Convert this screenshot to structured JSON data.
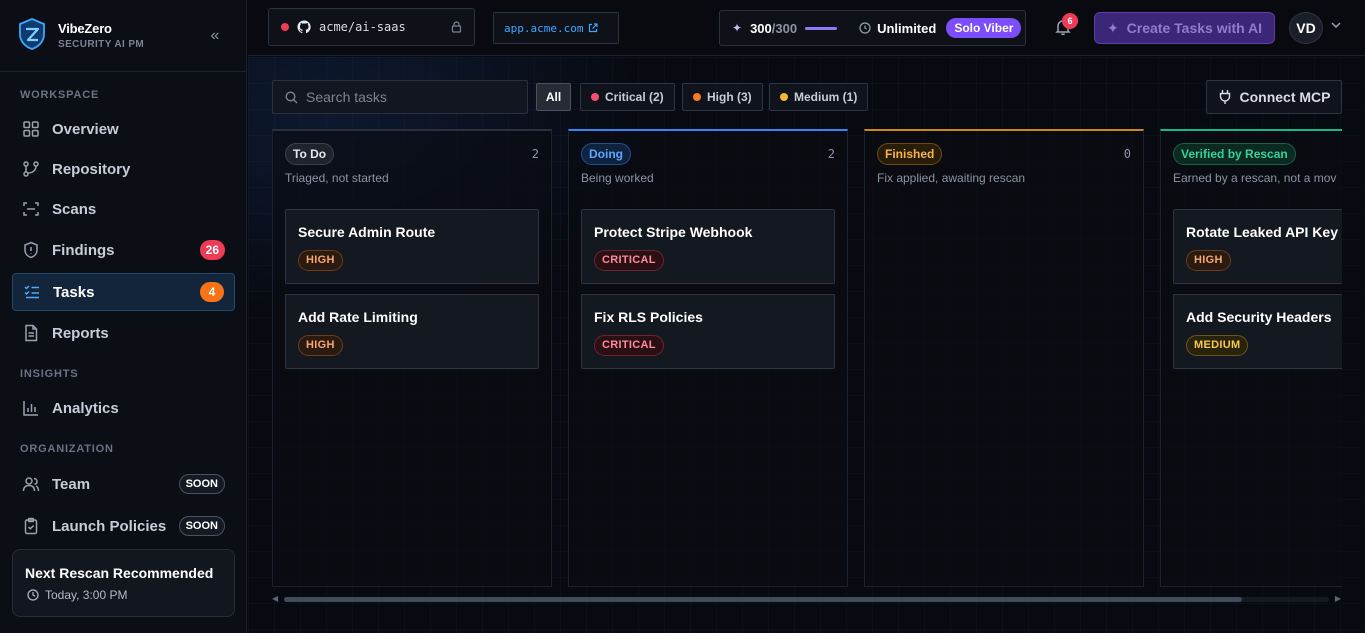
{
  "brand": {
    "name": "VibeZero",
    "subtitle": "SECURITY AI PM"
  },
  "sidebar": {
    "sections": {
      "workspace": "WORKSPACE",
      "insights": "INSIGHTS",
      "organization": "ORGANIZATION"
    },
    "items": [
      {
        "label": "Overview",
        "icon": "grid-icon"
      },
      {
        "label": "Repository",
        "icon": "branch-icon"
      },
      {
        "label": "Scans",
        "icon": "scan-icon"
      },
      {
        "label": "Findings",
        "icon": "shield-icon",
        "badge": "26"
      },
      {
        "label": "Tasks",
        "icon": "checklist-icon",
        "badge": "4",
        "active": true
      },
      {
        "label": "Reports",
        "icon": "document-icon"
      },
      {
        "label": "Analytics",
        "icon": "bar-chart-icon"
      },
      {
        "label": "Team",
        "icon": "users-icon",
        "tag": "SOON"
      },
      {
        "label": "Launch Policies",
        "icon": "clipboard-icon",
        "tag": "SOON"
      }
    ],
    "rescan": {
      "title": "Next Rescan Recommended",
      "time": "Today, 3:00 PM"
    }
  },
  "topbar": {
    "repo": "acme/ai-saas",
    "url": "app.acme.com",
    "credits_used": "300",
    "credits_total": "/300",
    "credits_fraction": 1.0,
    "limit": "Unlimited",
    "plan": "Solo Viber",
    "notifications": "6",
    "create_label": "Create Tasks with AI",
    "avatar": "VD"
  },
  "toolbar": {
    "search_placeholder": "Search tasks",
    "filters": [
      {
        "label": "All",
        "active": true
      },
      {
        "label": "Critical (2)",
        "dot": "#f0506e"
      },
      {
        "label": "High (3)",
        "dot": "#f97a1f"
      },
      {
        "label": "Medium (1)",
        "dot": "#f5b82e"
      }
    ],
    "connect_label": "Connect MCP"
  },
  "columns": [
    {
      "name": "To Do",
      "count": "2",
      "desc": "Triaged, not started",
      "accent": "#2a303e",
      "pill_color": "#e6e8ee",
      "pill_bg": "#1e232e",
      "pill_border": "#3a4150",
      "cards": [
        {
          "title": "Secure Admin Route",
          "severity": "HIGH",
          "level": "high"
        },
        {
          "title": "Add Rate Limiting",
          "severity": "HIGH",
          "level": "high"
        }
      ]
    },
    {
      "name": "Doing",
      "count": "2",
      "desc": "Being worked",
      "accent": "#3b82f6",
      "pill_color": "#5aa8ff",
      "pill_bg": "#0f2340",
      "pill_border": "#1f4f8a",
      "cards": [
        {
          "title": "Protect Stripe Webhook",
          "severity": "CRITICAL",
          "level": "critical"
        },
        {
          "title": "Fix RLS Policies",
          "severity": "CRITICAL",
          "level": "critical"
        }
      ]
    },
    {
      "name": "Finished",
      "count": "0",
      "desc": "Fix applied, awaiting rescan",
      "accent": "#c98a1b",
      "pill_color": "#f5b54a",
      "pill_bg": "#2a1d08",
      "pill_border": "#6a4a14",
      "cards": []
    },
    {
      "name": "Verified by Rescan",
      "count": "",
      "desc": "Earned by a rescan, not a mov",
      "accent": "#14b88a",
      "pill_color": "#34d399",
      "pill_bg": "#0b2a21",
      "pill_border": "#17614a",
      "cards": [
        {
          "title": "Rotate Leaked API Key",
          "severity": "HIGH",
          "level": "high"
        },
        {
          "title": "Add Security Headers",
          "severity": "MEDIUM",
          "level": "medium"
        }
      ]
    }
  ],
  "colors": {
    "findings_badge": "#ef3b55",
    "tasks_badge": "#f97316",
    "accent_purple": "#7b4dff"
  }
}
